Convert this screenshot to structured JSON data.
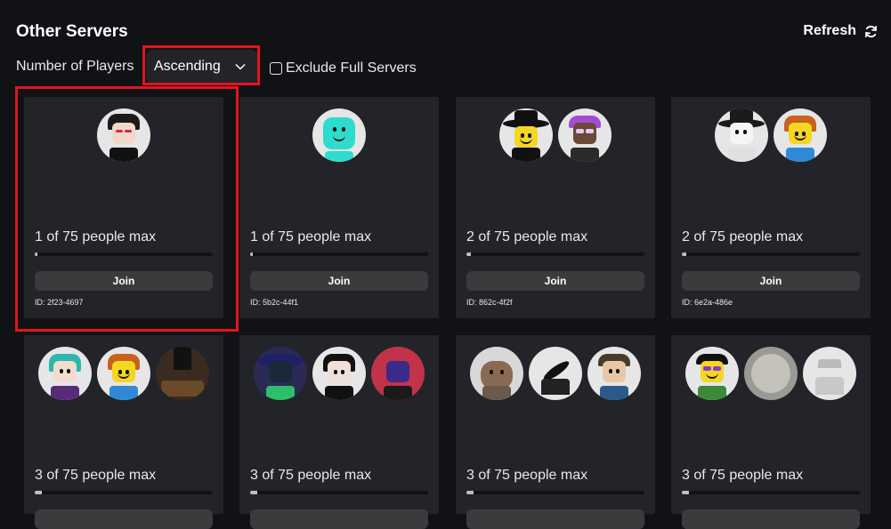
{
  "header": {
    "title": "Other Servers",
    "refresh_label": "Refresh",
    "refresh_icon": "refresh-icon"
  },
  "filters": {
    "sort_label": "Number of Players",
    "sort_value": "Ascending",
    "exclude_label": "Exclude Full Servers",
    "exclude_checked": false
  },
  "accent": "#e3141e",
  "servers": [
    {
      "players": "1 of 75 people max",
      "fill": 0.013,
      "join": "Join",
      "id": "ID: 2f23-4697"
    },
    {
      "players": "1 of 75 people max",
      "fill": 0.013,
      "join": "Join",
      "id": "ID: 5b2c-44f1"
    },
    {
      "players": "2 of 75 people max",
      "fill": 0.027,
      "join": "Join",
      "id": "ID: 862c-4f2f"
    },
    {
      "players": "2 of 75 people max",
      "fill": 0.027,
      "join": "Join",
      "id": "ID: 6e2a-486e"
    },
    {
      "players": "3 of 75 people max",
      "fill": 0.04
    },
    {
      "players": "3 of 75 people max",
      "fill": 0.04
    },
    {
      "players": "3 of 75 people max",
      "fill": 0.04
    },
    {
      "players": "3 of 75 people max",
      "fill": 0.04
    }
  ]
}
